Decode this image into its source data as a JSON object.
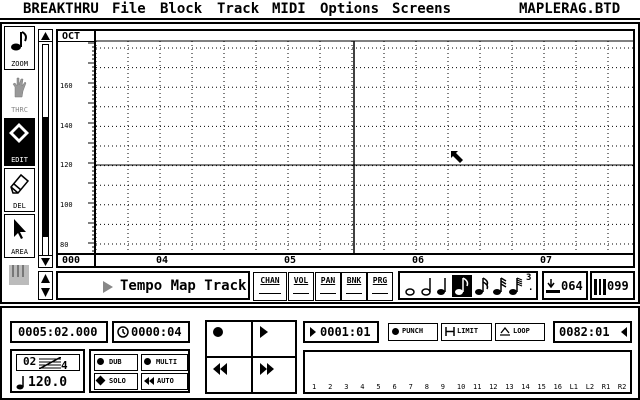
{
  "menubar": {
    "app": "BREAKTHRU",
    "items": [
      "File",
      "Block",
      "Track",
      "MIDI",
      "Options",
      "Screens"
    ],
    "filename": "MAPLERAG.BTD"
  },
  "tools": [
    {
      "label": "ZOOM"
    },
    {
      "label": "THRC"
    },
    {
      "label": "EDIT"
    },
    {
      "label": "DEL"
    },
    {
      "label": "AREA"
    },
    {
      "label": ""
    }
  ],
  "editor": {
    "oct_label": "OCT",
    "y_labels": [
      "160",
      "140",
      "120",
      "100",
      "80"
    ],
    "bar_labels": [
      "000",
      "04",
      "05",
      "06",
      "07"
    ]
  },
  "track_bar": {
    "track_name": "Tempo Map Track",
    "params": [
      "CHAN",
      "VOL",
      "PAN",
      "BNK",
      "PRG"
    ],
    "dot_label": ".",
    "three_label": "3",
    "value_a": "064",
    "value_b": "099"
  },
  "transport": {
    "position": "0005:02.000",
    "time": "0000:04",
    "time_sig_top": "02",
    "time_sig_bottom": "4",
    "tempo": "120.0",
    "dub": "DUB",
    "multi": "MULTI",
    "solo": "SOLO",
    "auto": "AUTO",
    "punch_in": "0001:01",
    "punch": "PUNCH",
    "limit": "LIMIT",
    "loop": "LOOP",
    "punch_out": "0082:01",
    "channels": [
      "1",
      "2",
      "3",
      "4",
      "5",
      "6",
      "7",
      "8",
      "9",
      "10",
      "11",
      "12",
      "13",
      "14",
      "15",
      "16",
      "L1",
      "L2",
      "R1",
      "R2"
    ]
  }
}
